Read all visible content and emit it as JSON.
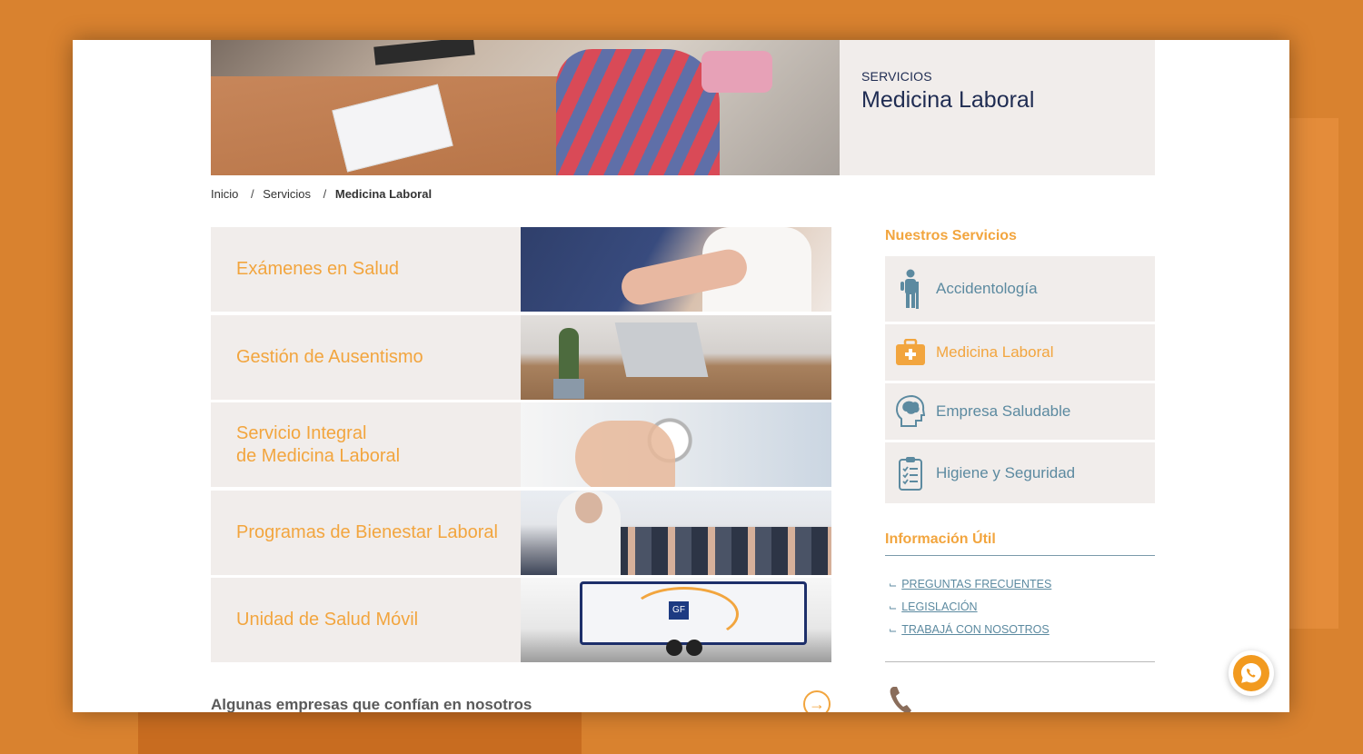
{
  "header": {
    "kicker": "SERVICIOS",
    "title": "Medicina Laboral"
  },
  "breadcrumb": {
    "items": [
      "Inicio",
      "Servicios"
    ],
    "separator": "/",
    "current": "Medicina Laboral"
  },
  "services": [
    {
      "label": "Exámenes en Salud"
    },
    {
      "label": "Gestión de Ausentismo"
    },
    {
      "label": "Servicio Integral\nde Medicina Laboral"
    },
    {
      "label": "Programas de Bienestar Laboral"
    },
    {
      "label": "Unidad de Salud Móvil"
    }
  ],
  "companies_heading": "Algunas empresas que confían en nosotros",
  "sidebar": {
    "title": "Nuestros Servicios",
    "items": [
      {
        "label": "Accidentología",
        "icon": "injured-person-icon"
      },
      {
        "label": "Medicina Laboral",
        "icon": "medical-briefcase-icon",
        "active": true
      },
      {
        "label": "Empresa Saludable",
        "icon": "head-profile-icon"
      },
      {
        "label": "Higiene y Seguridad",
        "icon": "clipboard-checklist-icon"
      }
    ]
  },
  "info": {
    "title": "Información Útil",
    "links": [
      "PREGUNTAS FRECUENTES",
      "LEGISLACIÓN",
      "TRABAJÁ CON NOSOTROS"
    ]
  },
  "colors": {
    "background": "#d9822f",
    "accent": "#f2a53e",
    "navy": "#1f2c52",
    "muted_blue": "#5c8aa0",
    "panel": "#f1edeb"
  },
  "mobile_unit_logo": "GF"
}
